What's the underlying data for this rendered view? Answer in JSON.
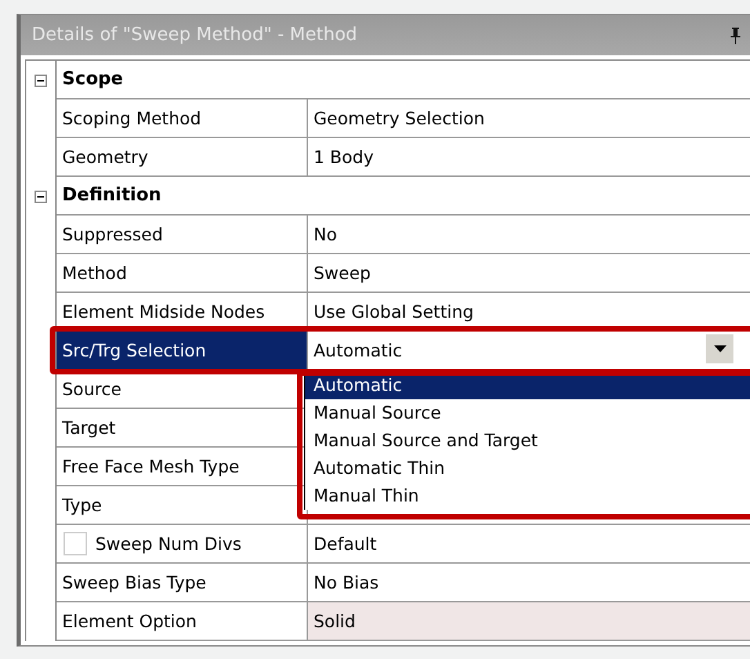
{
  "panel": {
    "title": "Details of \"Sweep Method\" - Method"
  },
  "groups": [
    {
      "name": "Scope",
      "expanded": true,
      "rows": [
        {
          "label": "Scoping Method",
          "value": "Geometry Selection"
        },
        {
          "label": "Geometry",
          "value": "1 Body"
        }
      ]
    },
    {
      "name": "Definition",
      "expanded": true,
      "rows": [
        {
          "label": "Suppressed",
          "value": "No"
        },
        {
          "label": "Method",
          "value": "Sweep"
        },
        {
          "label": "Element Midside Nodes",
          "value": "Use Global Setting"
        },
        {
          "label": "Src/Trg Selection",
          "value": "Automatic",
          "kind": "dropdown",
          "selected": true,
          "annotated": true,
          "options": [
            {
              "label": "Automatic",
              "selected": true
            },
            {
              "label": "Manual Source",
              "selected": false
            },
            {
              "label": "Manual Source and Target",
              "selected": false
            },
            {
              "label": "Automatic Thin",
              "selected": false
            },
            {
              "label": "Manual Thin",
              "selected": false
            }
          ]
        },
        {
          "label": "Source"
        },
        {
          "label": "Target"
        },
        {
          "label": "Free Face Mesh Type"
        },
        {
          "label": "Type"
        },
        {
          "label": "Sweep Num Divs",
          "value": "Default",
          "kind": "checkbox",
          "checked": false
        },
        {
          "label": "Sweep Bias Type",
          "value": "No Bias"
        },
        {
          "label": "Element Option",
          "value": "Solid",
          "kind": "readonly"
        }
      ]
    }
  ]
}
